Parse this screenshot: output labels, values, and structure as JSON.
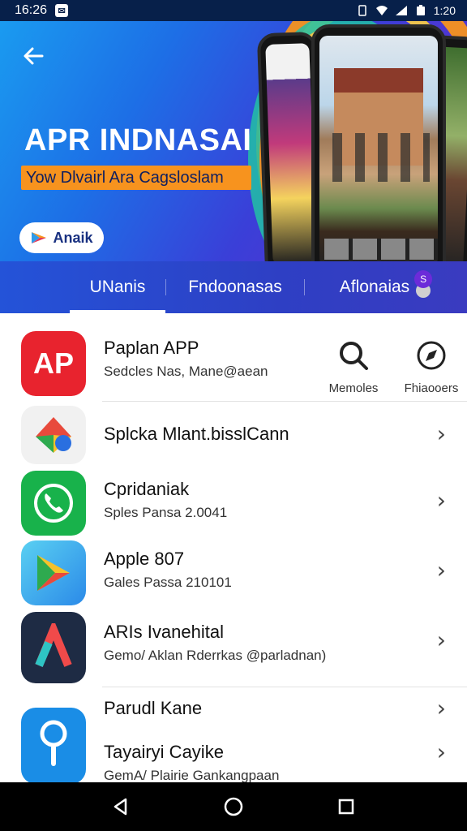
{
  "status": {
    "time": "16:26",
    "clock": "1:20"
  },
  "banner": {
    "title": "APR INDNASAI",
    "subtitle": "Yow Dlvairl Ara Cagsloslam",
    "button_label": "Anaik"
  },
  "tabs": [
    {
      "label": "UNanis",
      "active": true
    },
    {
      "label": "Fndoonasas",
      "active": false
    },
    {
      "label": "Aflonaias",
      "active": false,
      "badge": "S"
    }
  ],
  "featured": {
    "icon_text": "AP",
    "title": "Paplan APP",
    "subtitle": "Sedcles Nas, Mane@aean",
    "actions": [
      {
        "label": "Memoles",
        "icon": "search-icon"
      },
      {
        "label": "Fhiaooers",
        "icon": "compass-icon"
      }
    ]
  },
  "apps": [
    {
      "title": "Splcka Mlant.bisslCann",
      "subtitle": "",
      "icon": "maps-icon"
    },
    {
      "title": "Cpridaniak",
      "subtitle": "Sples Pansa 2.0041",
      "icon": "phone-icon"
    },
    {
      "title": "Apple 807",
      "subtitle": "Gales Passa 210101",
      "icon": "play-icon"
    },
    {
      "title": "ARIs Ivanehital",
      "subtitle": "Gemo/ Aklan Rderrkas @parladnan)",
      "icon": "a-logo-icon"
    },
    {
      "title": "Parudl Kane",
      "subtitle": "",
      "icon": "search-app-icon"
    },
    {
      "title": "Tayairyi Cayike",
      "subtitle": "GemA/ Plairie Gankangpaan",
      "icon": ""
    }
  ],
  "colors": {
    "accent_orange": "#f7931e",
    "tab_bg": "#2453d8",
    "nav_bg": "#000000"
  }
}
